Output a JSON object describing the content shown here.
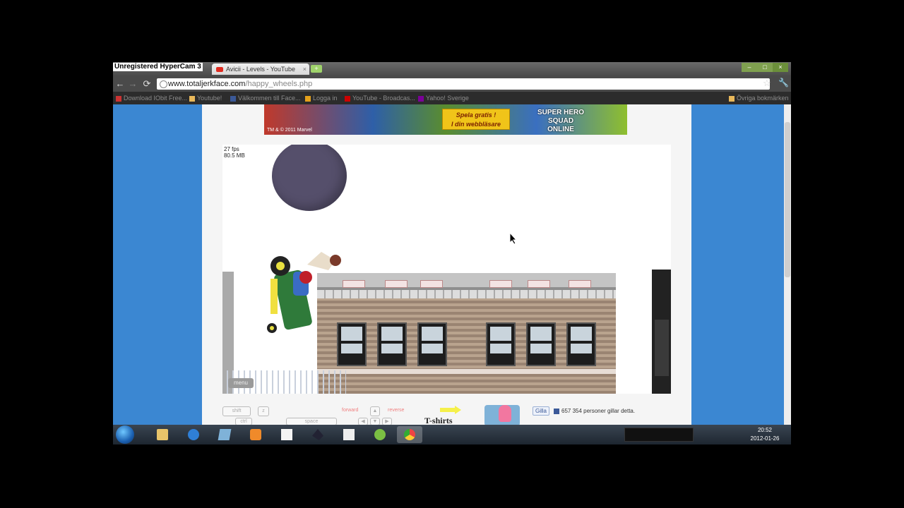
{
  "watermark": "Unregistered HyperCam 3",
  "browser": {
    "tab_title": "Avicii - Levels - YouTube",
    "tab_close": "×",
    "new_tab": "+",
    "window_buttons": {
      "min": "–",
      "max": "□",
      "close": "×"
    },
    "nav": {
      "back": "←",
      "forward": "→",
      "reload": "⟳"
    },
    "url_host": "www.totaljerkface.com",
    "url_path": "/happy_wheels.php",
    "bookmark_star": "☆",
    "wrench": "🔧",
    "bookmarks": [
      {
        "label": "Download IObit Free...",
        "color": "#cc3333"
      },
      {
        "label": "Youtube!",
        "color": "#e8b85a"
      },
      {
        "label": "Välkommen till Face...",
        "color": "#3b5998"
      },
      {
        "label": "Logga in",
        "color": "#e4a11b"
      },
      {
        "label": "YouTube - Broadcas...",
        "color": "#cc0000"
      },
      {
        "label": "Yahoo! Sverige",
        "color": "#7b0099"
      }
    ],
    "other_bookmarks": "Övriga bokmärken"
  },
  "banner": {
    "cta_line1": "Spela gratis !",
    "cta_line2": "I din webbläsare",
    "logo": "SUPER HERO SQUAD ONLINE",
    "copyright": "TM & © 2011 Marvel"
  },
  "game": {
    "fps": "27 fps",
    "memory": "80.5 MB",
    "menu_button": "menu"
  },
  "controls": {
    "shift": "shift",
    "z": "z",
    "ctrl": "ctrl",
    "space": "space",
    "forward": "forward",
    "reverse": "reverse"
  },
  "sidebar_promo": {
    "tshirts": "T-shirts",
    "like_button": "Gilla",
    "like_text": "657 354 personer gillar detta."
  },
  "taskbar": {
    "time": "20:52",
    "date": "2012-01-26",
    "apps": [
      {
        "name": "explorer",
        "color": "#e8c46a"
      },
      {
        "name": "internet-explorer",
        "color": "#2f7fd6"
      },
      {
        "name": "app-blue",
        "color": "#7fb2d8"
      },
      {
        "name": "media",
        "color": "#f08a2a"
      },
      {
        "name": "notepad",
        "color": "#f4f4f4"
      },
      {
        "name": "app-dark",
        "color": "#223"
      },
      {
        "name": "document",
        "color": "#eee"
      },
      {
        "name": "spotify",
        "color": "#7bc043"
      },
      {
        "name": "chrome",
        "color": "#e44"
      }
    ]
  }
}
